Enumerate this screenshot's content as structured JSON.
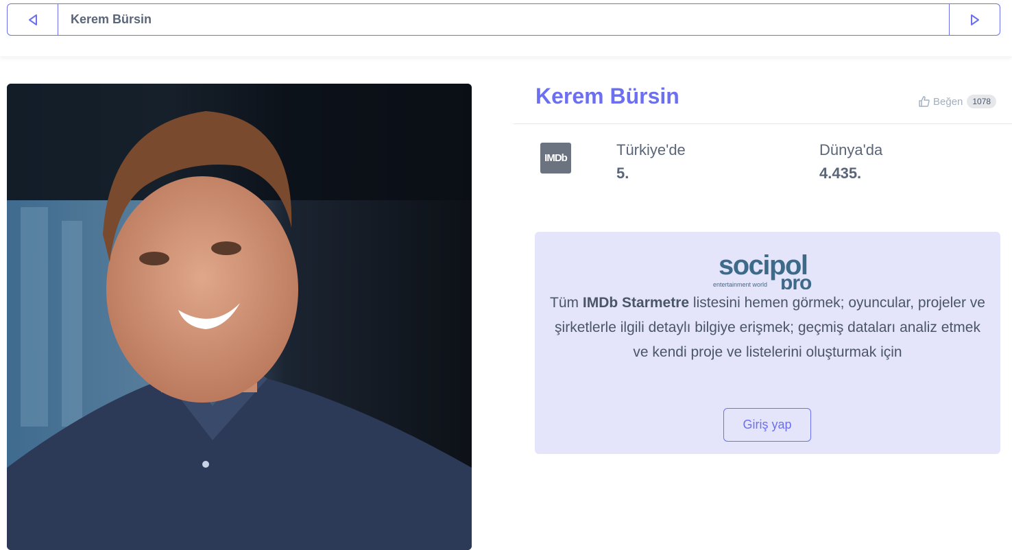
{
  "nav": {
    "title": "Kerem Bürsin",
    "prev_icon": "triangle-left-icon",
    "next_icon": "triangle-right-icon"
  },
  "profile": {
    "name": "Kerem Bürsin",
    "like_label": "Beğen",
    "like_count": "1078",
    "photo_alt": "Kerem Bürsin"
  },
  "rankings": {
    "source_logo_text": "IMDb",
    "turkey_label": "Türkiye'de",
    "turkey_value": "5.",
    "world_label": "Dünya'da",
    "world_value": "4.435."
  },
  "promo": {
    "brand_main": "socipol",
    "brand_sub": "pro",
    "brand_tagline": "entertainment world",
    "text_before": "Tüm ",
    "text_bold": "IMDb Starmetre",
    "text_after": " listesini hemen görmek; oyuncular, projeler ve şirketlerle ilgili detaylı bilgiye erişmek; geçmiş dataları analiz etmek ve kendi proje ve listelerini oluşturmak için",
    "login_label": "Giriş yap"
  },
  "colors": {
    "accent": "#6b6ff0",
    "promo_bg": "#e4e5fb",
    "brand": "#3e6a8a"
  }
}
